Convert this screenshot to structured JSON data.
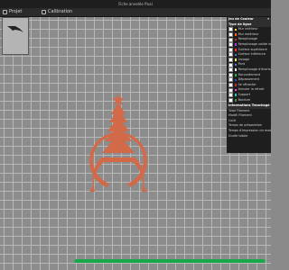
{
  "window": {
    "title": "Fiche annelée final"
  },
  "toolbar": {
    "tab_project": "Projet",
    "tab_calibration": "Calibration"
  },
  "legend_panel": {
    "color_scheme_label": "Jeu de Couleur",
    "line_types_header": "Type de ligne",
    "line_types": [
      {
        "label": "Mur intérieur",
        "color": "#ffd13b"
      },
      {
        "label": "Mur extérieur",
        "color": "#ff5c1f"
      },
      {
        "label": "Remplissage",
        "color": "#b5392b"
      },
      {
        "label": "Remplissage solide interne",
        "color": "#9b3be0"
      },
      {
        "label": "Surface supérieure",
        "color": "#ff2b2b"
      },
      {
        "label": "Surface inférieure",
        "color": "#4a6cd9"
      },
      {
        "label": "Lissage",
        "color": "#e8e85a"
      },
      {
        "label": "Pont",
        "color": "#3a7fd9"
      },
      {
        "label": "Remplissage d'écarts",
        "color": "#e6e6e6"
      },
      {
        "label": "Raccordement",
        "color": "#30b050"
      },
      {
        "label": "Dépassement",
        "color": "#2f4fc8"
      },
      {
        "label": "Se rétracter",
        "color": "#c83030"
      },
      {
        "label": "Annuler la retrait",
        "color": "#f04ad0"
      },
      {
        "label": "Support",
        "color": "#30c8b0"
      },
      {
        "label": "Bordure",
        "color": "#3f8f3f"
      }
    ],
    "slicing_info_header": "Informations Tranchage",
    "slicing_info": [
      "Total Filament",
      "Modèl Filament",
      "Coût",
      "Temps de préparation",
      "Temps d'impression du modèle",
      "Durée totale"
    ]
  },
  "print_progress": {
    "fraction": 1.0
  },
  "colors": {
    "model": "#d26a4a",
    "progress": "#18a84a",
    "background": "#8a8a8a"
  }
}
